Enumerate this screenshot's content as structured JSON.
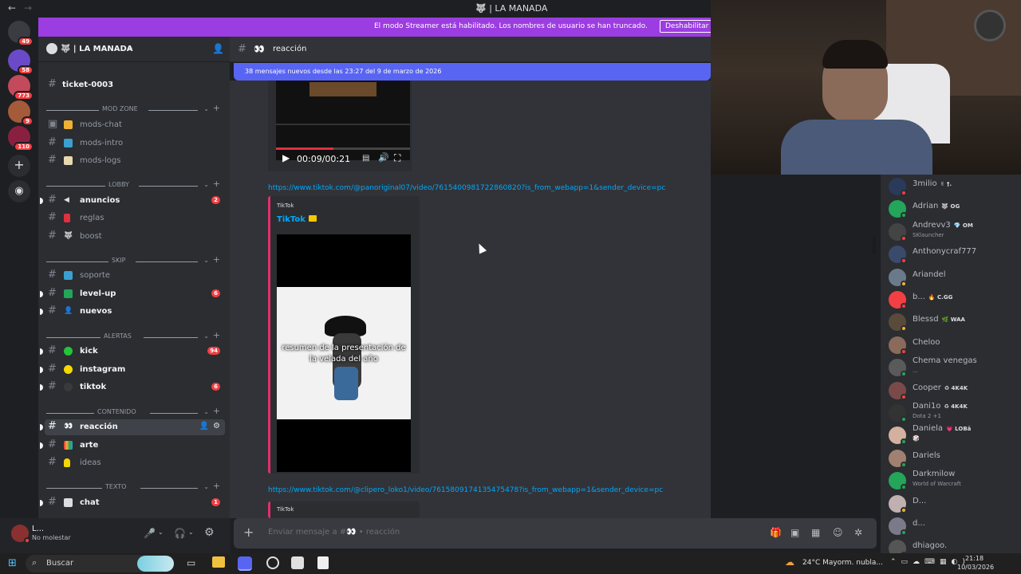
{
  "window": {
    "title": "🐺 | LA MANADA",
    "back": "←",
    "forward": "→"
  },
  "rail": {
    "servers": [
      {
        "badge": "49",
        "color": "#3a3c42"
      },
      {
        "badge": "58",
        "color": "#6b4ac7"
      },
      {
        "badge": "773",
        "color": "#c24a5a"
      },
      {
        "badge": "9",
        "color": "#a55a3a"
      },
      {
        "badge": "110",
        "color": "#8a2040"
      }
    ]
  },
  "banner": {
    "message": "El modo Streamer está habilitado. Los nombres de usuario se han truncado.",
    "button": "Deshabilitar"
  },
  "server": {
    "name": "🐺 | LA MANADA"
  },
  "channels": {
    "ticket": "ticket-0003",
    "cat_mod": "MOD ZONE",
    "mods_chat": "mods-chat",
    "mods_intro": "mods-intro",
    "mods_logs": "mods-logs",
    "cat_lobby": "LOBBY",
    "anuncios": "anuncios",
    "anuncios_badge": "2",
    "reglas": "reglas",
    "boost": "boost",
    "cat_skip": "SKIP",
    "soporte": "soporte",
    "level_up": "level-up",
    "level_up_badge": "6",
    "nuevos": "nuevos",
    "cat_alertas": "ALERTAS",
    "kick": "kick",
    "kick_badge": "94",
    "instagram": "instagram",
    "tiktok": "tiktok",
    "tiktok_badge": "6",
    "cat_contenido": "CONTENIDO",
    "reaccion": "reacción",
    "arte": "arte",
    "ideas": "ideas",
    "cat_texto": "TEXTO",
    "chat": "chat",
    "chat_badge": "1"
  },
  "user": {
    "name": "L...",
    "status": "No molestar"
  },
  "chat_header": {
    "channel": "reacción"
  },
  "new_messages": "38 mensajes nuevos desde las 23:27 del 9 de marzo de 2026",
  "messages": {
    "video_time": "00:09/00:21",
    "link1": "https://www.tiktok.com/@panoriginal07/video/7615400981722860820?is_from_webapp=1&sender_device=pc",
    "embed_provider": "TikTok",
    "embed_title": "TikTok",
    "video_caption": "resumen de la presentación de la velada del año",
    "link2": "https://www.tiktok.com/@clipero_loko1/video/7615809174135475478?is_from_webapp=1&sender_device=pc",
    "embed_provider2": "TikTok"
  },
  "composer": {
    "placeholder": "Enviar mensaje a #👀 • reacción"
  },
  "members": [
    {
      "name": "3milio",
      "tag": "✌ †.",
      "status": "#f23f43",
      "avatar": "#2a3a5a"
    },
    {
      "name": "Adrian",
      "tag": "🐺 OG",
      "status": "#23a55a",
      "avatar": "#23a55a"
    },
    {
      "name": "Andrevv3",
      "tag": "💎 OM",
      "sub": "SKlauncher",
      "status": "#f23f43",
      "avatar": "#444"
    },
    {
      "name": "Anthonycraf777",
      "tag": "",
      "status": "#f23f43",
      "avatar": "#3a4a6a"
    },
    {
      "name": "Ariandel",
      "tag": "",
      "status": "#f0b232",
      "avatar": "#6a7a8a"
    },
    {
      "name": "b...",
      "tag": "🔥 C.GG",
      "status": "#f23f43",
      "avatar": "#f23f43"
    },
    {
      "name": "Blessd",
      "tag": "🌿 WAA",
      "status": "#f0b232",
      "avatar": "#5a4a3a"
    },
    {
      "name": "Cheloo",
      "tag": "",
      "status": "#f23f43",
      "avatar": "#8a6a5a"
    },
    {
      "name": "Chema venegas",
      "tag": "",
      "sub": "...",
      "status": "#23a55a",
      "avatar": "#5a5a5a"
    },
    {
      "name": "Cooper",
      "tag": "♻ 4K4K",
      "status": "#f23f43",
      "avatar": "#7a4a4a"
    },
    {
      "name": "Dani1o",
      "tag": "♻ 4K4K",
      "sub": "Dota 2 +1",
      "status": "#23a55a",
      "avatar": "#333"
    },
    {
      "name": "Daniela",
      "tag": "💗 LOBā",
      "sub": "🎲",
      "status": "#23a55a",
      "avatar": "#d4b0a0"
    },
    {
      "name": "Dariels",
      "tag": "",
      "status": "#23a55a",
      "avatar": "#a08070"
    },
    {
      "name": "Darkmilow",
      "tag": "",
      "sub": "World of Warcraft",
      "status": "#23a55a",
      "avatar": "#23a55a"
    },
    {
      "name": "D...",
      "tag": "",
      "status": "#f0b232",
      "avatar": "#c0b0b0"
    },
    {
      "name": "d...",
      "tag": "",
      "status": "#23a55a",
      "avatar": "#7a7a8a"
    },
    {
      "name": "dhiagoo.",
      "tag": "",
      "status": "#23a55a",
      "avatar": "#555"
    }
  ],
  "taskbar": {
    "search": "Buscar",
    "weather": "24°C  Mayorm. nubla...",
    "time": "21:18",
    "date": "10/03/2026"
  }
}
